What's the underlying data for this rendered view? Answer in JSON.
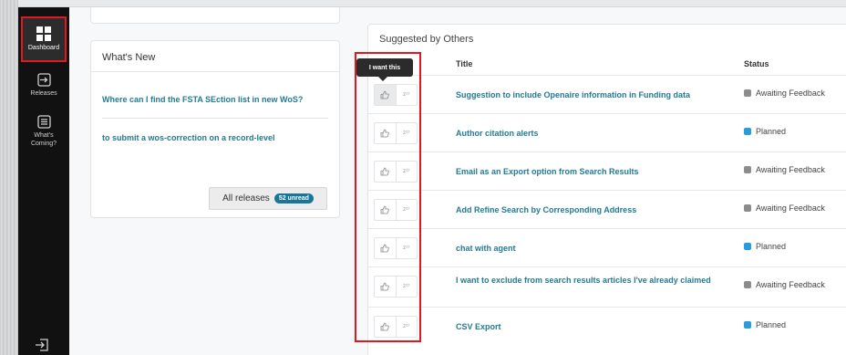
{
  "sidebar": {
    "items": [
      {
        "label": "Dashboard",
        "icon": "dashboard-grid-icon"
      },
      {
        "label": "Releases",
        "icon": "releases-icon"
      },
      {
        "label": "What's Coming?",
        "icon": "whats-coming-icon"
      }
    ],
    "logout_icon": "logout-icon"
  },
  "whats_new": {
    "title": "What's New",
    "links": [
      "Where can I find the FSTA SEction list in new WoS?",
      "to submit a wos-correction on a record-level"
    ],
    "all_releases_label": "All releases",
    "unread_badge": "52 unread"
  },
  "suggested": {
    "title": "Suggested by Others",
    "tooltip": "I want this",
    "columns": {
      "title": "Title",
      "status": "Status"
    },
    "rows": [
      {
        "title": "Suggestion to include Openaire information in Funding data",
        "status": "Awaiting Feedback",
        "status_color": "#8c8c8c"
      },
      {
        "title": "Author citation alerts",
        "status": "Planned",
        "status_color": "#2b9be0"
      },
      {
        "title": "Email as an Export option from Search Results",
        "status": "Awaiting Feedback",
        "status_color": "#8c8c8c"
      },
      {
        "title": "Add Refine Search by Corresponding Address",
        "status": "Awaiting Feedback",
        "status_color": "#8c8c8c"
      },
      {
        "title": "chat with agent",
        "status": "Planned",
        "status_color": "#2b9be0"
      },
      {
        "title": "I want to exclude from search results articles I've already claimed",
        "status": "Awaiting Feedback",
        "status_color": "#8c8c8c"
      },
      {
        "title": "CSV Export",
        "status": "Planned",
        "status_color": "#2b9be0"
      }
    ],
    "vote_icons": {
      "like": "thumbs-up-icon",
      "snooze": "snooze-icon"
    },
    "snooze_glyph": "zᶻᶻ"
  }
}
